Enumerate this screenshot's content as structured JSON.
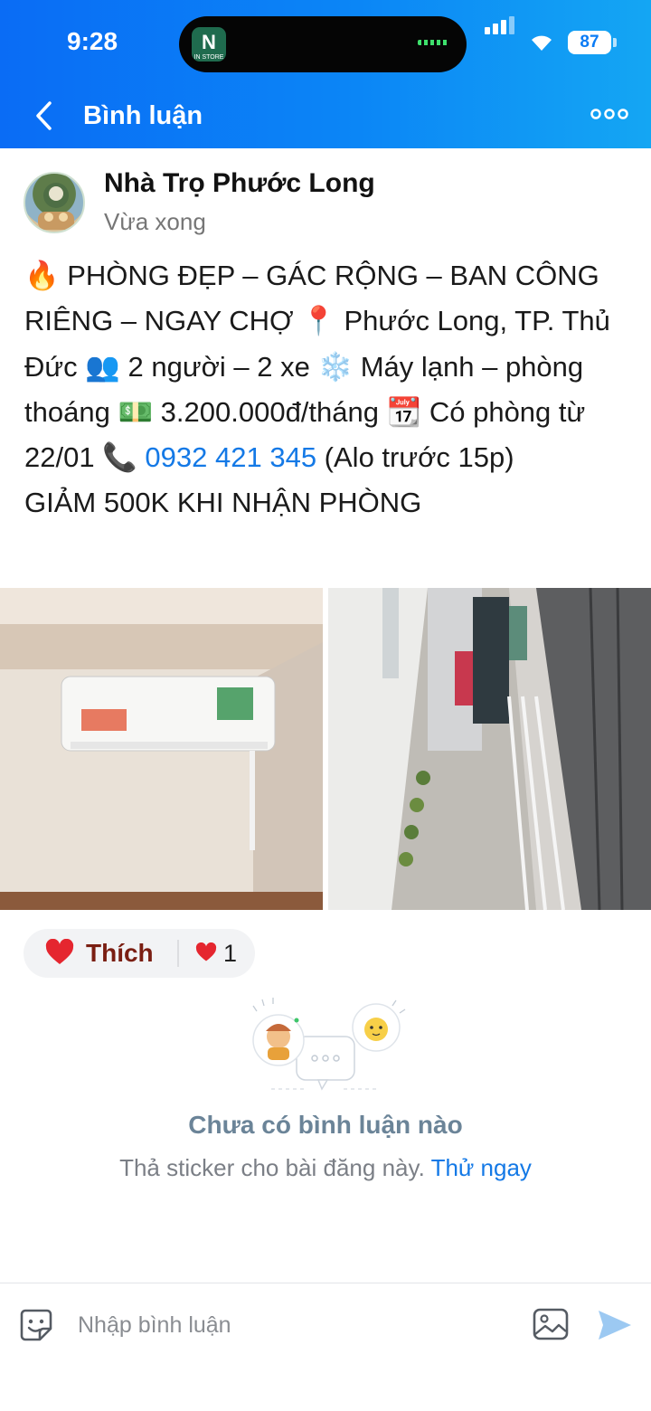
{
  "status_bar": {
    "time": "9:28",
    "battery": "87",
    "island_app_glyph": "N",
    "island_app_caption": "IN STORE"
  },
  "header": {
    "title": "Bình luận"
  },
  "post": {
    "author": "Nhà Trọ Phước Long",
    "time": "Vừa xong",
    "body": {
      "fire": "🔥",
      "t1": " PHÒNG ĐẸP – GÁC RỘNG – BAN CÔNG RIÊNG – NGAY CHỢ ",
      "pin": "📍",
      "t2": " Phước Long, TP. Thủ Đức ",
      "people": "👥",
      "t3": " 2 người – 2 xe ",
      "snow": "❄️",
      "t4": " Máy lạnh – phòng thoáng ",
      "money": "💵",
      "t5": " 3.200.000đ/tháng ",
      "calendar": "📆",
      "t6": " Có phòng từ 22/01 ",
      "phone_icon": "📞",
      "phone": " 0932 421 345",
      "t7": " (Alo trước 15p)",
      "line2": "GIẢM 500K KHI NHẬN PHÒNG"
    }
  },
  "reactions": {
    "like_label": "Thích",
    "count": "1"
  },
  "comments": {
    "empty_title": "Chưa có bình luận nào",
    "empty_subtitle": "Thả sticker cho bài đăng này.",
    "try_link": "Thử ngay"
  },
  "composer": {
    "placeholder": "Nhập bình luận"
  },
  "icons": {
    "back": "chevron-left-icon",
    "more": "more-horizontal-icon",
    "sticker": "sticker-smile-icon",
    "photo": "image-icon",
    "send": "send-icon",
    "like": "heart-icon"
  },
  "colors": {
    "header_start": "#0a6cf5",
    "header_end": "#14a6f3",
    "link": "#1479e6",
    "like_heart": "#e5262f",
    "like_text": "#7a1e12",
    "empty_title": "#6b8498"
  }
}
